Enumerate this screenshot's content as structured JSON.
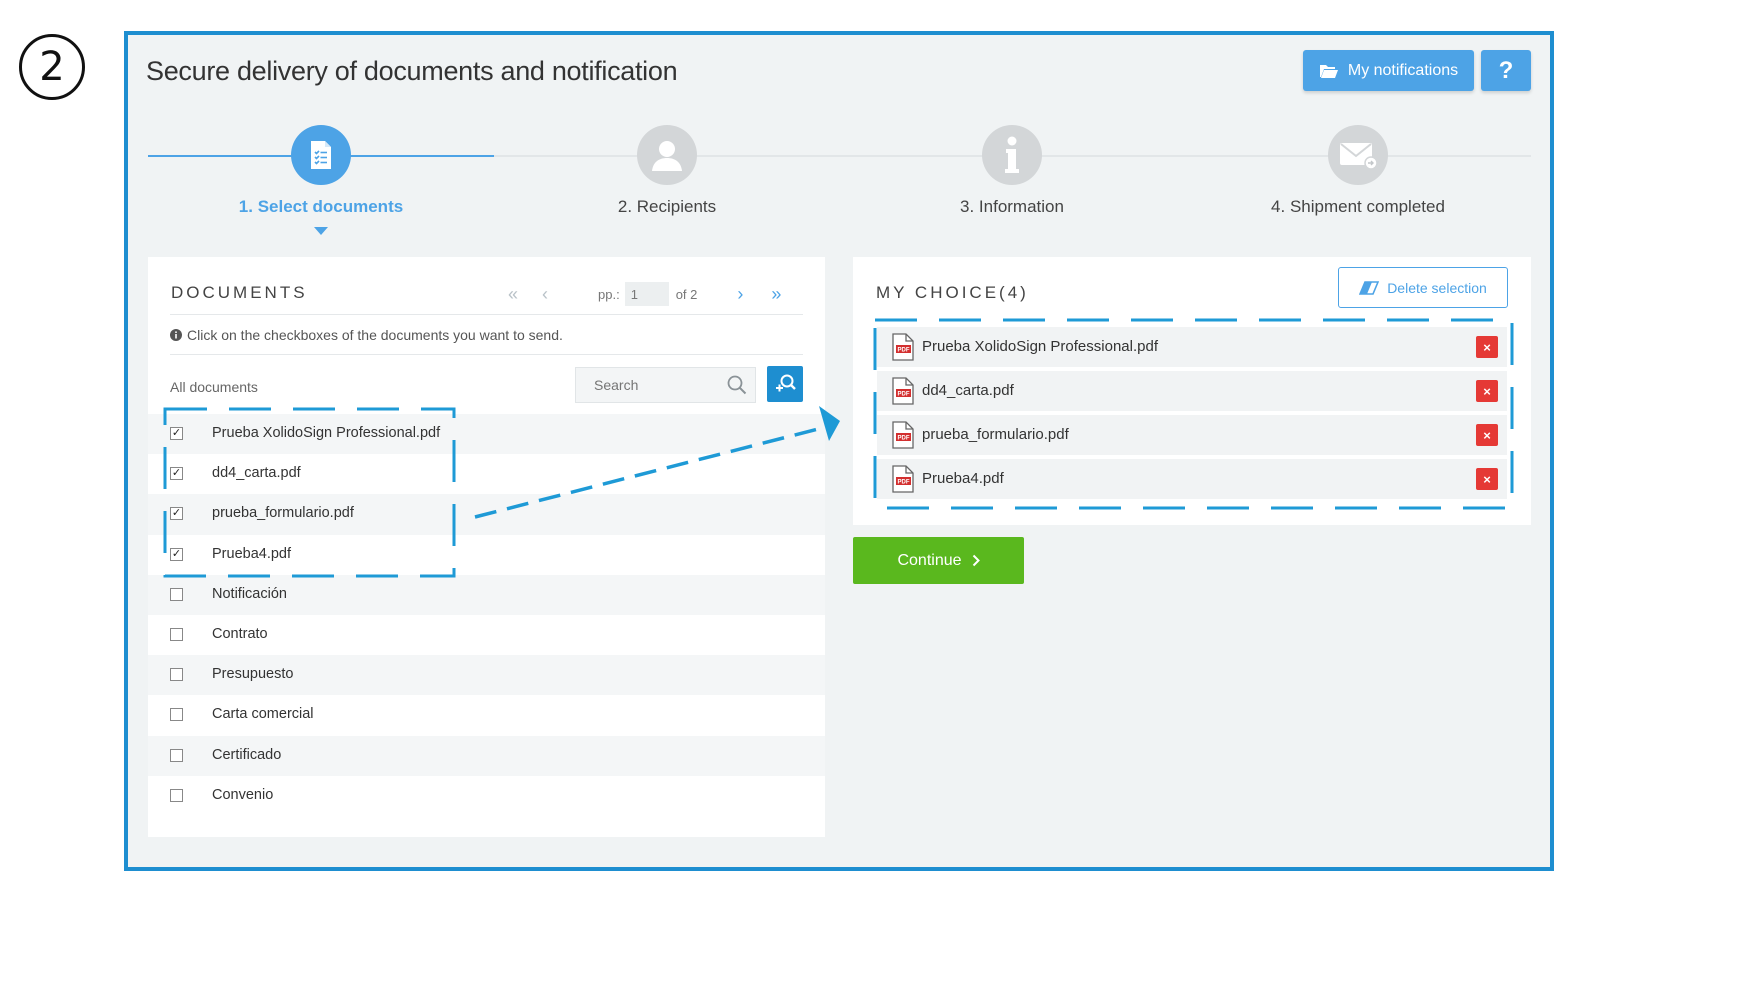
{
  "step_badge": "2",
  "page_title": "Secure delivery of documents and notification",
  "header": {
    "notifications_label": "My notifications",
    "notifications_icon": "folder-open-icon",
    "help_label": "?"
  },
  "stepper": {
    "active_step": 1,
    "steps": [
      {
        "label": "1. Select documents",
        "icon": "document-list-icon"
      },
      {
        "label": "2. Recipients",
        "icon": "user-icon"
      },
      {
        "label": "3. Information",
        "icon": "info-icon"
      },
      {
        "label": "4. Shipment completed",
        "icon": "envelope-icon"
      }
    ]
  },
  "documents": {
    "heading": "DOCUMENTS",
    "pager": {
      "prefix": "pp.:",
      "page": "1",
      "of": "of 2"
    },
    "hint": "Click on the checkboxes of the documents you want to send.",
    "filter_label": "All documents",
    "search_placeholder": "Search",
    "items": [
      {
        "name": "Prueba XolidoSign Professional.pdf",
        "checked": true
      },
      {
        "name": "dd4_carta.pdf",
        "checked": true
      },
      {
        "name": "prueba_formulario.pdf",
        "checked": true
      },
      {
        "name": "Prueba4.pdf",
        "checked": true
      },
      {
        "name": "Notificación",
        "checked": false
      },
      {
        "name": "Contrato",
        "checked": false
      },
      {
        "name": "Presupuesto",
        "checked": false
      },
      {
        "name": "Carta comercial",
        "checked": false
      },
      {
        "name": "Certificado",
        "checked": false
      },
      {
        "name": "Convenio",
        "checked": false
      }
    ]
  },
  "choice": {
    "heading": "MY CHOICE(4)",
    "delete_selection_label": "Delete selection",
    "items": [
      {
        "name": "Prueba XolidoSign Professional.pdf"
      },
      {
        "name": "dd4_carta.pdf"
      },
      {
        "name": "prueba_formulario.pdf"
      },
      {
        "name": "Prueba4.pdf"
      }
    ],
    "remove_glyph": "×"
  },
  "continue_label": "Continue",
  "colors": {
    "accent": "#4da3e6",
    "frame": "#1e8ed0",
    "continue": "#5ab81e",
    "remove": "#e53935",
    "annotation": "#1e9ad6"
  }
}
